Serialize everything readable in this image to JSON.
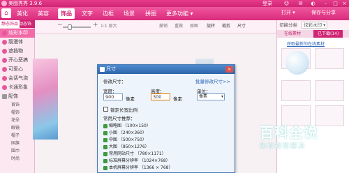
{
  "app": {
    "title": "美图秀秀 3.9.6",
    "login": "登录"
  },
  "menu": {
    "tabs": [
      "美化",
      "美容",
      "饰品",
      "文字",
      "边框",
      "场景",
      "拼图",
      "更多功能 ▾"
    ],
    "active_tab": "饰品",
    "open": "打开 ▾",
    "save": "保存与分享"
  },
  "left_panel": {
    "tabs": [
      "静态饰品",
      "动态饰品"
    ],
    "items": [
      "炫彩水印",
      "靓漫体",
      "遮挡物",
      "开心恶搞",
      "可爱心",
      "会话气泡",
      "卡通形象",
      "配饰"
    ],
    "selected_item": "炫彩水印",
    "sub_items": [
      "首饰",
      "帽饰",
      "花朵",
      "眼镜",
      "帽子",
      "国旗",
      "围巾",
      "时尚"
    ]
  },
  "toolbar": {
    "zoom_minus": "−",
    "zoom_plus": "+",
    "actual_size": "1:1 原大",
    "undo": "撤销",
    "redo": "重做",
    "reset": "原图",
    "rotate": "旋转",
    "crop": "裁剪",
    "resize": "尺寸",
    "watermark_label": "切换分类",
    "watermark_select": "炫彩水印 ▾"
  },
  "right_panel": {
    "tabs": [
      "在线素材",
      "已下载(14)"
    ],
    "link": "获取最新的在线素材"
  },
  "dialog": {
    "title": "尺寸",
    "close": "×",
    "section": "修改尺寸：",
    "batch_link": "批量修改尺寸>>",
    "width_label": "宽度：",
    "width_value": "900",
    "height_label": "高度：",
    "height_value": "300",
    "unit_label": "单位：",
    "unit_px": "像素",
    "lock_ratio": "锁定长宽比例",
    "preset_title": "常用尺寸推荐：",
    "presets": [
      "缩略图 （100×150）",
      "小图 （240×360）",
      "中图 （500×750）",
      "大图 （850×1276）",
      "常用网站尺寸 （780×1171）",
      "标准屏幕分辨率 （1024×768）",
      "本机屏幕分辨率 （1366 × 768）"
    ]
  },
  "watermark": {
    "title": "百科全说",
    "subtitle": "助你轻松解决"
  }
}
